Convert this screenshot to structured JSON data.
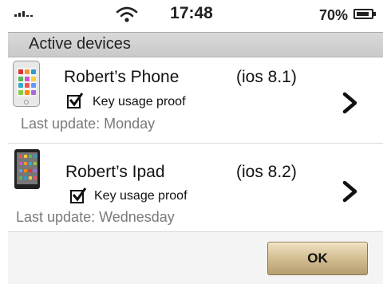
{
  "status_bar": {
    "time": "17:48",
    "battery_percent": "70%",
    "icons": [
      "signal-icon",
      "wifi-icon",
      "battery-icon"
    ]
  },
  "section": {
    "title": "Active devices"
  },
  "devices": [
    {
      "name": "Robert’s Phone",
      "os": "(ios 8.1)",
      "checkbox_label": "Key usage proof",
      "checked": true,
      "last_update": "Last update: Monday",
      "icon": "iphone-icon"
    },
    {
      "name": "Robert’s Ipad",
      "os": "(ios 8.2)",
      "checkbox_label": "Key usage proof",
      "checked": true,
      "last_update": "Last update: Wednesday",
      "icon": "ipad-icon"
    }
  ],
  "footer": {
    "ok_label": "OK"
  },
  "colors": {
    "header_bg": "#d0d0d0",
    "button_top": "#efe2c4",
    "button_bottom": "#b59e6f",
    "secondary_text": "#7a7a7a"
  }
}
